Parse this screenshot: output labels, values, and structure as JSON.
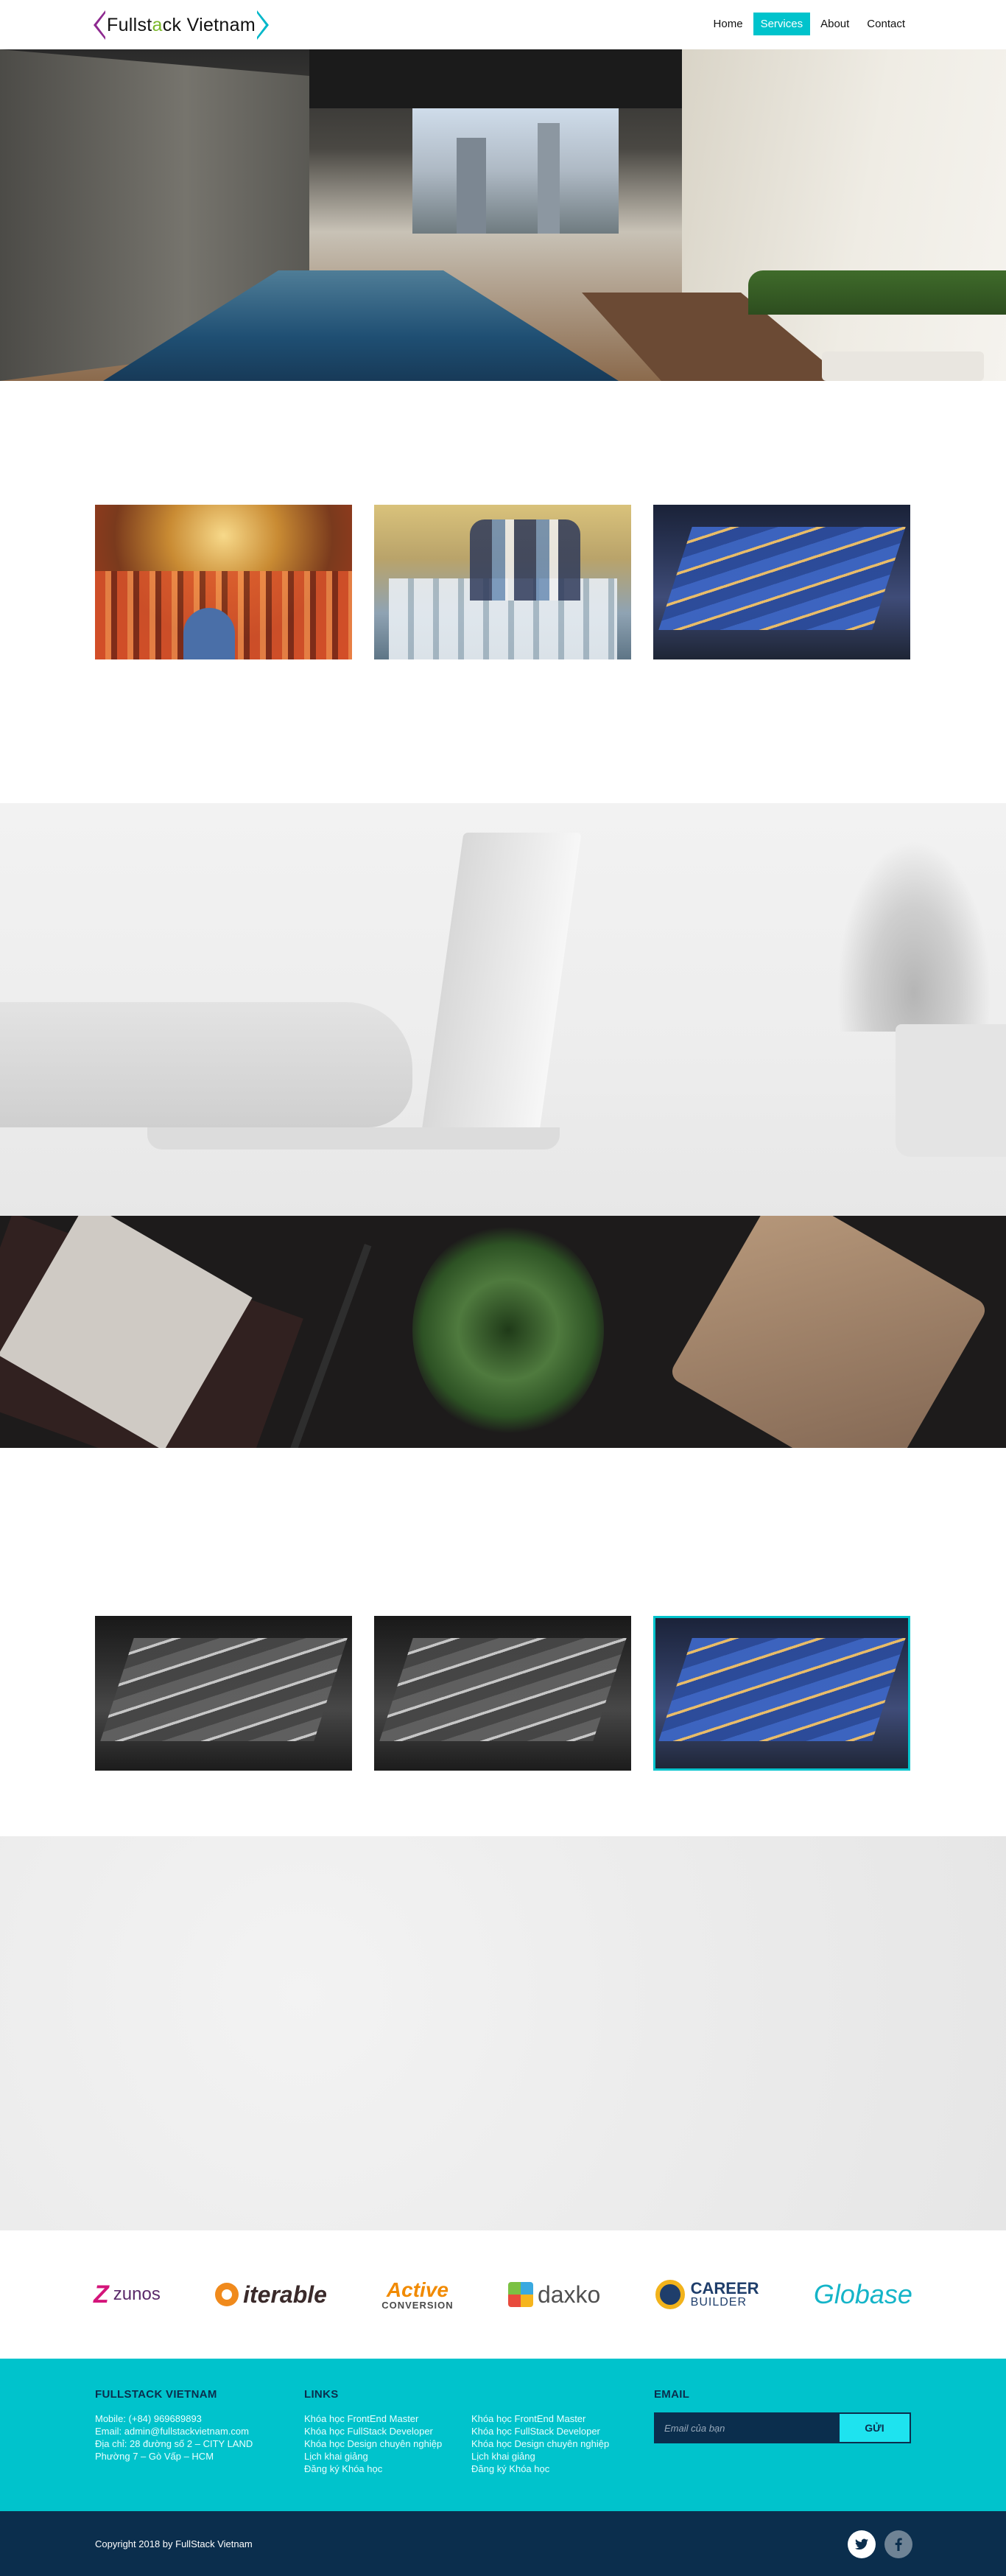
{
  "header": {
    "logo_part1": "Fullst",
    "logo_accent": "a",
    "logo_part2": "ck Vietnam",
    "nav": [
      "Home",
      "Services",
      "About",
      "Contact"
    ],
    "active_nav": "Services"
  },
  "logos": [
    "zunos",
    "iterable",
    "Active",
    "CONVERSION",
    "daxko",
    "CAREER",
    "BUILDER",
    "Globase"
  ],
  "footer": {
    "about_title": "FULLSTACK VIETNAM",
    "about_lines": [
      "Mobile: (+84) 969689893",
      "Email: admin@fullstackvietnam.com",
      "Địa chỉ: 28 đường số 2 – CITY LAND",
      "Phường 7 – Gò Vấp – HCM"
    ],
    "links_title": "LINKS",
    "links_col1": [
      "Khóa học FrontEnd Master",
      "Khóa học FullStack Developer",
      "Khóa học Design chuyên nghiệp",
      "Lịch khai giảng",
      "Đăng ký Khóa học"
    ],
    "links_col2": [
      "Khóa học FrontEnd Master",
      "Khóa học FullStack Developer",
      "Khóa học Design chuyên nghiệp",
      "Lịch khai giảng",
      "Đăng ký Khóa học"
    ],
    "email_title": "EMAIL",
    "email_placeholder": "Email của bạn",
    "email_button": "GỬI",
    "copyright": "Copyright 2018 by FullStack Vietnam",
    "social_icons": [
      "twitter-icon",
      "facebook-icon"
    ]
  },
  "colors": {
    "accent": "#00c3cc",
    "navy": "#0b2e4d",
    "logo_purple": "#8e2a90",
    "logo_green": "#7ab829"
  }
}
